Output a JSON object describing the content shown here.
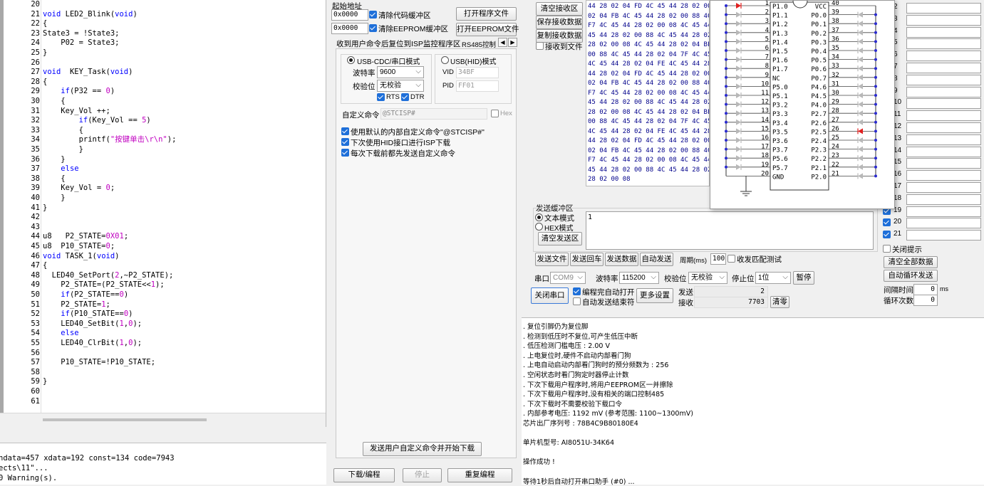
{
  "editor": {
    "lines": [
      {
        "n": "20",
        "t": ""
      },
      {
        "n": "21",
        "t": "void LED2_Blink(void)"
      },
      {
        "n": "22",
        "t": "{"
      },
      {
        "n": "23",
        "t": "State3 = !State3;"
      },
      {
        "n": "24",
        "t": "    P02 = State3;"
      },
      {
        "n": "25",
        "t": "}"
      },
      {
        "n": "26",
        "t": ""
      },
      {
        "n": "27",
        "t": "void  KEY_Task(void)"
      },
      {
        "n": "28",
        "t": "{"
      },
      {
        "n": "29",
        "t": "    if(P32 == 0)"
      },
      {
        "n": "30",
        "t": "    {"
      },
      {
        "n": "31",
        "t": "    Key_Vol ++;"
      },
      {
        "n": "32",
        "t": "        if(Key_Vol == 5)"
      },
      {
        "n": "33",
        "t": "        {"
      },
      {
        "n": "34",
        "t": "        printf(\"按键单击\\r\\n\");"
      },
      {
        "n": "35",
        "t": "        }"
      },
      {
        "n": "36",
        "t": "    }"
      },
      {
        "n": "37",
        "t": "    else"
      },
      {
        "n": "38",
        "t": "    {"
      },
      {
        "n": "39",
        "t": "    Key_Vol = 0;"
      },
      {
        "n": "40",
        "t": "    }"
      },
      {
        "n": "41",
        "t": "}"
      },
      {
        "n": "42",
        "t": ""
      },
      {
        "n": "43",
        "t": ""
      },
      {
        "n": "44",
        "t": "u8   P2_STATE=0X01;"
      },
      {
        "n": "45",
        "t": "u8  P10_STATE=0;"
      },
      {
        "n": "46",
        "t": "void TASK_1(void)"
      },
      {
        "n": "47",
        "t": "{"
      },
      {
        "n": "48",
        "t": "  LED40_SetPort(2,~P2_STATE);"
      },
      {
        "n": "49",
        "t": "    P2_STATE=(P2_STATE<<1);"
      },
      {
        "n": "50",
        "t": "    if(P2_STATE==0)"
      },
      {
        "n": "51",
        "t": "    P2_STATE=1;"
      },
      {
        "n": "52",
        "t": "    if(P10_STATE==0)"
      },
      {
        "n": "53",
        "t": "    LED40_SetBit(1,0);"
      },
      {
        "n": "54",
        "t": "    else"
      },
      {
        "n": "55",
        "t": "    LED40_ClrBit(1,0);"
      },
      {
        "n": "56",
        "t": ""
      },
      {
        "n": "57",
        "t": "    P10_STATE=!P10_STATE;"
      },
      {
        "n": "58",
        "t": ""
      },
      {
        "n": "59",
        "t": "}"
      },
      {
        "n": "60",
        "t": ""
      },
      {
        "n": "61",
        "t": ""
      }
    ]
  },
  "output": {
    "lines": [
      "ndata=457 xdata=192 const=134 code=7943",
      "ects\\11\"...",
      "0 Warning(s)."
    ]
  },
  "isp": {
    "start_addr_label": "起始地址",
    "code_addr": "0x0000",
    "eeprom_addr": "0x0000",
    "clear_code": "清除代码缓冲区",
    "clear_eeprom": "清除EEPROM缓冲区",
    "open_program": "打开程序文件",
    "open_eeprom": "打开EEPROM文件",
    "reset_hint": "收到用户命令后复位到ISP监控程序区",
    "rs485_tab": "RS485控制",
    "usb_cdc": "USB-CDC/串口模式",
    "usb_hid": "USB(HID)模式",
    "baud_label": "波特率",
    "baud_value": "9600",
    "parity_label": "校验位",
    "parity_value": "无校验",
    "rts": "RTS",
    "dtr": "DTR",
    "vid_label": "VID",
    "vid_value": "34BF",
    "pid_label": "PID",
    "pid_value": "FF01",
    "custom_cmd_label": "自定义命令",
    "custom_cmd_value": "@STCISP#",
    "hex_label": "Hex",
    "opt1": "使用默认的内部自定义命令\"@STCISP#\"",
    "opt2": "下次使用HID接口进行ISP下载",
    "opt3": "每次下载前都先发送自定义命令",
    "send_start": "发送用户自定义命令并开始下载",
    "download": "下载/编程",
    "stop": "停止",
    "reprogram": "重复编程"
  },
  "serial": {
    "clear_rx": "清空接收区",
    "save_rx": "保存接收数据",
    "copy_rx": "复制接收数据",
    "rx_to_file": "接收到文件",
    "rx_hex": [
      "44 28 02 04 FD 4C 45 44 28 02 00",
      "02 04 FB 4C 45 44 28 02 00 88 4C",
      "F7 4C 45 44 28 02 00 08 4C 45 44",
      "45 44 28 02 00 88 4C 45 44 28 02",
      "28 02 00 08 4C 45 44 28 02 04 BF",
      "00 88 4C 45 44 28 02 04 7F 4C 45",
      "4C 45 44 28 02 04 FE 4C 45 44 28",
      "44 28 02 04 FD 4C 45 44 28 02 00",
      "02 04 FB 4C 45 44 28 02 00 88 4C",
      "F7 4C 45 44 28 02 00 08 4C 45 44",
      "45 44 28 02 00 88 4C 45 44 28 02",
      "28 02 00 08 4C 45 44 28 02 04 BF",
      "00 88 4C 45 44 28 02 04 7F 4C 45",
      "4C 45 44 28 02 04 FE 4C 45 44 28",
      "44 28 02 04 FD 4C 45 44 28 02 00",
      "02 04 FB 4C 45 44 28 02 00 88 4C",
      "F7 4C 45 44 28 02 00 08 4C 45 44",
      "45 44 28 02 00 88 4C 45 44 28 02",
      "28 02 00 08"
    ],
    "send_buffer_label": "发送缓冲区",
    "text_mode": "文本模式",
    "hex_mode": "HEX模式",
    "clear_send": "清空发送区",
    "send_text": "1",
    "send_file": "发送文件",
    "send_return": "发送回车",
    "send_data": "发送数据",
    "auto_send": "自动发送",
    "period_label": "周期(ms)",
    "period_value": "100",
    "close_match": "收发匹配测试",
    "port_label": "串口",
    "port_value": "COM9",
    "baud_label": "波特率",
    "baud_value": "115200",
    "parity_label": "校验位",
    "parity_value": "无校验",
    "stop_label": "停止位",
    "stop_value": "1位",
    "pause": "暂停",
    "close_port": "关闭串口",
    "auto_open": "编程完自动打开",
    "auto_send_end": "自动发送结束符",
    "more_settings": "更多设置",
    "send_count_label": "发送",
    "send_count": "2",
    "recv_count_label": "接收",
    "recv_count": "7703",
    "clear_count": "清零",
    "rows": [
      "2",
      "3",
      "4",
      "5",
      "6",
      "7",
      "8",
      "9",
      "10",
      "11",
      "12",
      "13",
      "14",
      "15",
      "16",
      "17",
      "18",
      "19",
      "20",
      "21"
    ],
    "close_hint": "关闭提示",
    "clear_all": "清空全部数据",
    "auto_loop": "自动循环发送",
    "interval_label": "间隔时间",
    "interval_value": "0",
    "interval_unit": "ms",
    "loop_label": "循环次数",
    "loop_value": "0"
  },
  "chip": {
    "left_pins": [
      {
        "num": "1",
        "name": "P1.0"
      },
      {
        "num": "2",
        "name": "P1.1"
      },
      {
        "num": "3",
        "name": "P1.2"
      },
      {
        "num": "4",
        "name": "P1.3"
      },
      {
        "num": "5",
        "name": "P1.4"
      },
      {
        "num": "6",
        "name": "P1.5"
      },
      {
        "num": "7",
        "name": "P1.6"
      },
      {
        "num": "8",
        "name": "P1.7"
      },
      {
        "num": "9",
        "name": "NC"
      },
      {
        "num": "10",
        "name": "P5.0"
      },
      {
        "num": "11",
        "name": "P5.1"
      },
      {
        "num": "12",
        "name": "P3.2"
      },
      {
        "num": "13",
        "name": "P3.3"
      },
      {
        "num": "14",
        "name": "P3.4"
      },
      {
        "num": "15",
        "name": "P3.5"
      },
      {
        "num": "16",
        "name": "P3.6"
      },
      {
        "num": "17",
        "name": "P3.7"
      },
      {
        "num": "18",
        "name": "P5.6"
      },
      {
        "num": "19",
        "name": "P5.7"
      },
      {
        "num": "20",
        "name": "GND"
      }
    ],
    "right_pins": [
      {
        "num": "40",
        "name": "VCC"
      },
      {
        "num": "39",
        "name": "P0.0"
      },
      {
        "num": "38",
        "name": "P0.1"
      },
      {
        "num": "37",
        "name": "P0.2"
      },
      {
        "num": "36",
        "name": "P0.3"
      },
      {
        "num": "35",
        "name": "P0.4"
      },
      {
        "num": "34",
        "name": "P0.5"
      },
      {
        "num": "33",
        "name": "P0.6"
      },
      {
        "num": "32",
        "name": "P0.7"
      },
      {
        "num": "31",
        "name": "P4.6"
      },
      {
        "num": "30",
        "name": "P4.5"
      },
      {
        "num": "29",
        "name": "P4.0"
      },
      {
        "num": "28",
        "name": "P2.7"
      },
      {
        "num": "27",
        "name": "P2.6"
      },
      {
        "num": "26",
        "name": "P2.5"
      },
      {
        "num": "25",
        "name": "P2.4"
      },
      {
        "num": "24",
        "name": "P2.3"
      },
      {
        "num": "23",
        "name": "P2.2"
      },
      {
        "num": "22",
        "name": "P2.1"
      },
      {
        "num": "21",
        "name": "P2.0"
      }
    ],
    "lit_led_color": "#e02020"
  },
  "log": {
    "lines": [
      "  . 复位引脚仍为复位脚",
      "  . 检测到低压时不复位,可产生低压中断",
      "  . 低压检测门槛电压 : 2.00 V",
      "  . 上电复位时,硬件不启动内部看门狗",
      "  . 上电自动启动内部看门狗时的预分频数为 : 256",
      "  . 空闲状态时看门狗定时器停止计数",
      "  . 下次下载用户程序时,将用户EEPROM区一并擦除",
      "  . 下次下载用户程序时,没有相关的端口控制485",
      "  . 下次下载时不需要校验下载口令",
      "  . 内部参考电压: 1192 mV (参考范围: 1100~1300mV)",
      "芯片出厂序列号 : 78B4C9B80180E4",
      "",
      "  单片机型号: AI8051U-34K64",
      "",
      "操作成功 !",
      "",
      "等待1秒后自动打开串口助手 (#0) ..."
    ]
  }
}
